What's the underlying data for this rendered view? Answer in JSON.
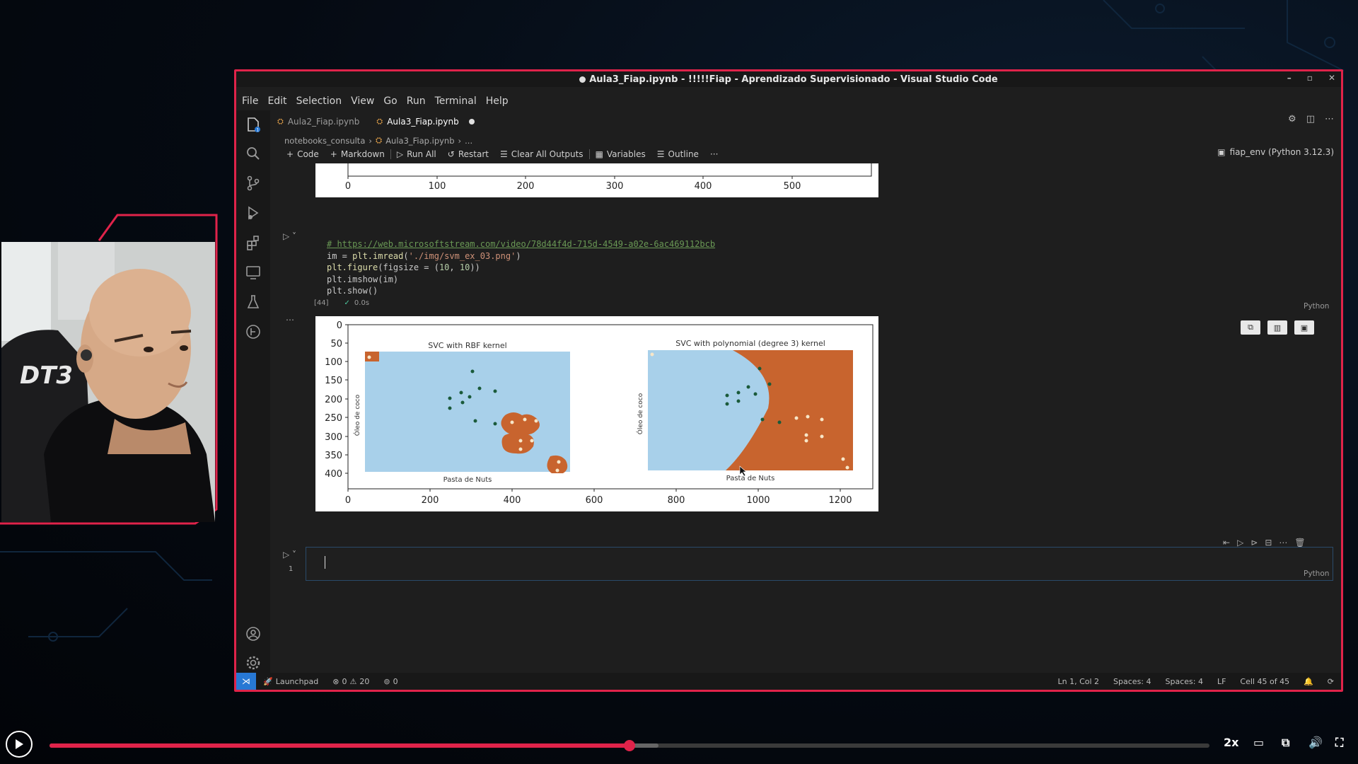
{
  "window": {
    "title": "Aula3_Fiap.ipynb - !!!!!Fiap - Aprendizado Supervisionado - Visual Studio Code",
    "controls": [
      "–",
      "▫",
      "✕"
    ]
  },
  "menu": [
    "File",
    "Edit",
    "Selection",
    "View",
    "Go",
    "Run",
    "Terminal",
    "Help"
  ],
  "tabs": [
    {
      "label": "Aula2_Fiap.ipynb",
      "active": false
    },
    {
      "label": "Aula3_Fiap.ipynb",
      "active": true
    }
  ],
  "breadcrumb": {
    "folder": "notebooks_consulta",
    "file": "Aula3_Fiap.ipynb",
    "more": "..."
  },
  "toolbar": {
    "code": "Code",
    "markdown": "Markdown",
    "run_all": "Run All",
    "restart": "Restart",
    "clear_outputs": "Clear All Outputs",
    "variables": "Variables",
    "outline": "Outline",
    "more": "···"
  },
  "kernel": "fiap_env (Python 3.12.3)",
  "prev_output_axis": [
    "0",
    "100",
    "200",
    "300",
    "400",
    "500"
  ],
  "cell": {
    "lines": {
      "l1": "# https://web.microsoftstream.com/video/78d44f4d-715d-4549-a02e-6ac469112bcb",
      "l2a": "im = ",
      "l2b": "plt.imread",
      "l2c": "(",
      "l2d": "'./img/svm_ex_03.png'",
      "l2e": ")",
      "l3a": "plt.figure",
      "l3b": "(figsize = (",
      "l3c": "10",
      "l3d": ", ",
      "l3e": "10",
      "l3f": "))",
      "l4": "plt.imshow(im)",
      "l5": "plt.show()"
    },
    "exec_count": "[44]",
    "exec_status": "✓",
    "exec_time": "0.0s",
    "language": "Python"
  },
  "figure": {
    "x_ticks": [
      "0",
      "200",
      "400",
      "600",
      "800",
      "1000",
      "1200"
    ],
    "y_ticks": [
      "0",
      "50",
      "100",
      "150",
      "200",
      "250",
      "300",
      "350",
      "400"
    ],
    "left_title": "SVC with RBF kernel",
    "right_title": "SVC with polynomial (degree 3) kernel",
    "xlabel": "Pasta de Nuts",
    "ylabel": "Óleo de coco"
  },
  "new_cell": {
    "language": "Python",
    "line_no": "1"
  },
  "status": {
    "launchpad": "Launchpad",
    "errors": "0",
    "warnings": "20",
    "ports": "0",
    "position": "Ln 1, Col 2",
    "spaces1": "Spaces: 4",
    "spaces2": "Spaces: 4",
    "eol": "LF",
    "cell": "Cell 45 of 45"
  },
  "player": {
    "speed": "2x",
    "progress": 0.5,
    "buffered": 0.525
  },
  "colors": {
    "frame": "#e0234a",
    "accent": "#2778d4",
    "rbf_bg": "#a8d0ea",
    "orange": "#c8642e"
  }
}
